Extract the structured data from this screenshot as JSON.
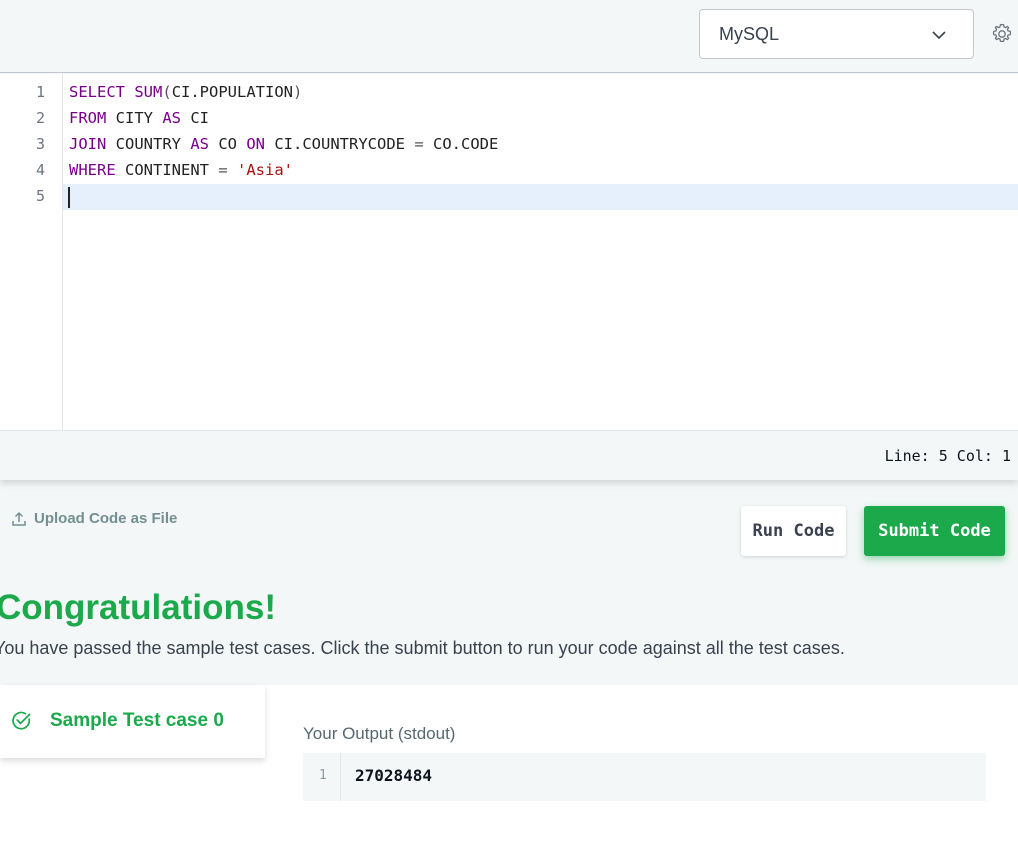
{
  "toolbar": {
    "language": "MySQL",
    "settings_icon": "gear-icon",
    "dropdown_icon": "chevron-down-icon"
  },
  "editor": {
    "line_numbers": [
      "1",
      "2",
      "3",
      "4",
      "5"
    ],
    "lines": [
      "SELECT SUM(CI.POPULATION)",
      "FROM CITY AS CI",
      "JOIN COUNTRY AS CO ON CI.COUNTRYCODE = CO.CODE",
      "WHERE CONTINENT = 'Asia'",
      ""
    ],
    "status": "Line: 5 Col: 1"
  },
  "actions": {
    "upload_label": "Upload Code as File",
    "run_label": "Run Code",
    "submit_label": "Submit Code"
  },
  "result": {
    "title": "Congratulations!",
    "message": "You have passed the sample test cases. Click the submit button to run your code against all the test cases.",
    "testcase_label": "Sample Test case 0",
    "output_label": "Your Output (stdout)",
    "output_line_number": "1",
    "output_value": "27028484"
  },
  "colors": {
    "accent_green": "#1ba94c",
    "keyword": "#770088",
    "string": "#aa1111",
    "active_line": "#e6f0fc"
  }
}
